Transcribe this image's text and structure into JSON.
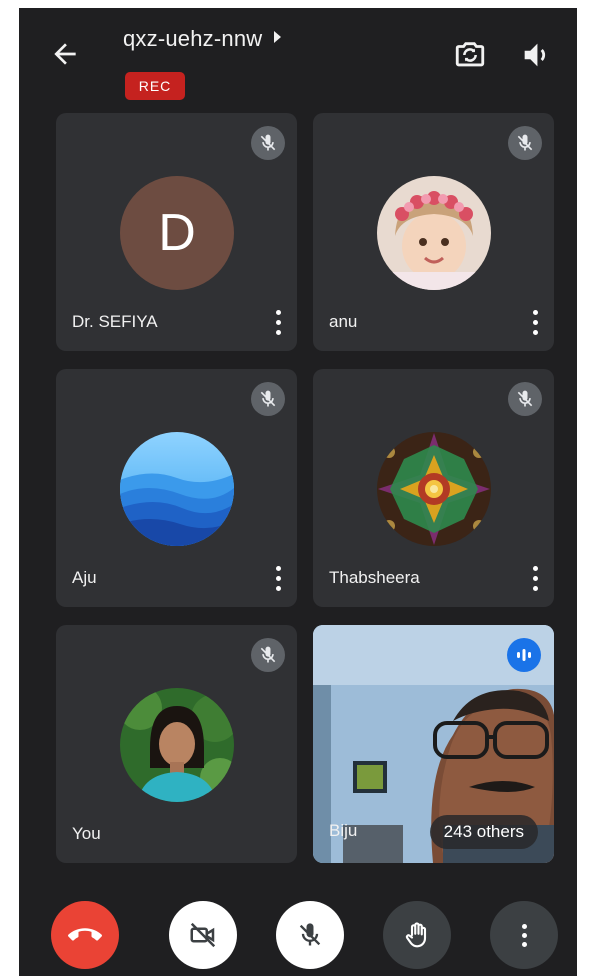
{
  "meeting": {
    "code": "qxz-uehz-nnw",
    "rec_label": "REC"
  },
  "icons": {
    "back": "arrow-back-icon",
    "switch_camera": "switch-camera-icon",
    "speaker": "speaker-icon",
    "mic_off": "mic-off-icon",
    "more": "more-vert-icon",
    "speaking": "speaking-indicator-icon"
  },
  "participants": [
    {
      "name": "Dr. SEFIYA",
      "avatar": "letter",
      "initial": "D",
      "muted": true
    },
    {
      "name": "anu",
      "avatar": "photo-child-with-flower-crown",
      "muted": true
    },
    {
      "name": "Aju",
      "avatar": "blue-mountains-image",
      "muted": true
    },
    {
      "name": "Thabsheera",
      "avatar": "mandala-image",
      "muted": true
    },
    {
      "name": "You",
      "avatar": "photo-woman",
      "muted": true
    },
    {
      "name": "Biju",
      "avatar": "live-video-man-with-glasses",
      "speaking": true,
      "others_label": "243 others"
    }
  ],
  "controls": [
    {
      "name": "end-call",
      "icon": "phone-hangup-icon",
      "color": "#ea4335"
    },
    {
      "name": "camera-off",
      "icon": "videocam-off-icon",
      "color": "#ffffff"
    },
    {
      "name": "mic-off",
      "icon": "mic-off-icon",
      "color": "#ffffff"
    },
    {
      "name": "raise-hand",
      "icon": "hand-icon",
      "color": "#3c4043"
    },
    {
      "name": "more-options",
      "icon": "more-vert-icon",
      "color": "#3c4043"
    }
  ],
  "colors": {
    "background": "#1f1f21",
    "tile": "#303134",
    "rec": "#c5221f",
    "end_call": "#ea4335",
    "speaking": "#1a73e8",
    "avatar_d": "#6d4c41"
  }
}
